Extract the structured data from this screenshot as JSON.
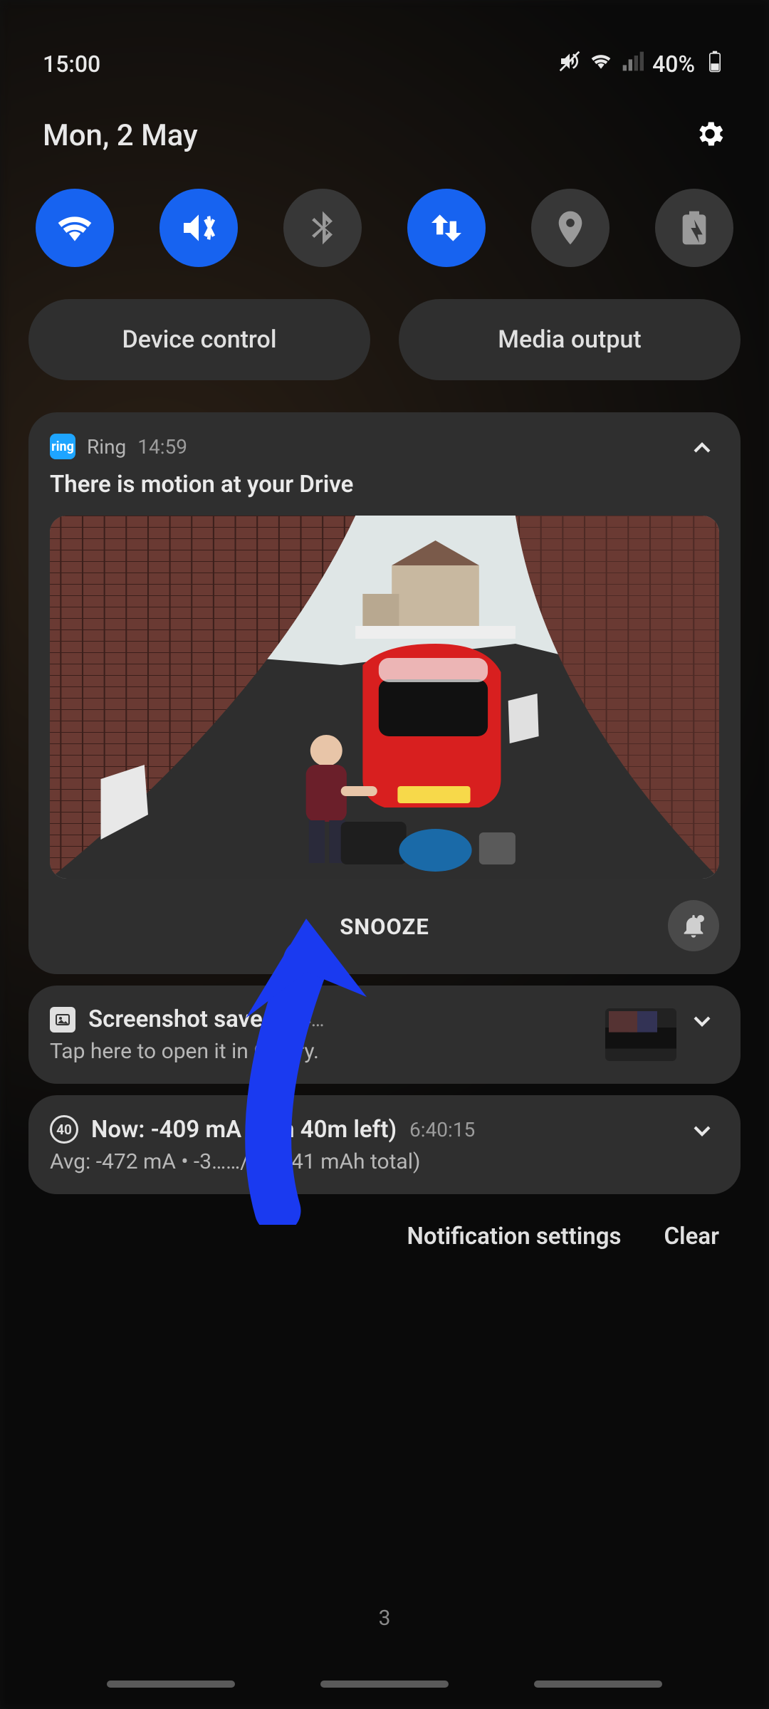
{
  "status": {
    "time": "15:00",
    "battery_pct": "40%"
  },
  "date": "Mon, 2 May",
  "quick_settings": {
    "device_control": "Device control",
    "media_output": "Media output"
  },
  "notifications": {
    "ring": {
      "app_name": "Ring",
      "time": "14:59",
      "title": "There is motion at your Drive",
      "snooze_label": "SNOOZE"
    },
    "screenshot": {
      "title": "Screenshot saved",
      "time_fragment": "14…",
      "body_fragment": "Tap here to open it in G……ry."
    },
    "battery": {
      "badge": "40",
      "title_fragment": "Now: -409 mA ……h 40m left)",
      "clock": "6:40:15",
      "body_fragment": "Avg: -472 mA • -3……/h (-941 mAh total)"
    }
  },
  "footer": {
    "settings": "Notification settings",
    "clear": "Clear"
  },
  "nav": {
    "count": "3"
  }
}
